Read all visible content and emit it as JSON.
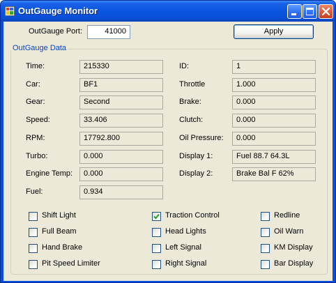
{
  "window": {
    "title": "OutGauge Monitor"
  },
  "port": {
    "label": "OutGauge Port:",
    "value": "41000",
    "apply_label": "Apply"
  },
  "group": {
    "title": "OutGauge Data"
  },
  "fields_left": [
    {
      "label": "Time:",
      "value": "215330"
    },
    {
      "label": "Car:",
      "value": "BF1"
    },
    {
      "label": "Gear:",
      "value": "Second"
    },
    {
      "label": "Speed:",
      "value": "33.406"
    },
    {
      "label": "RPM:",
      "value": "17792.800"
    },
    {
      "label": "Turbo:",
      "value": "0.000"
    },
    {
      "label": "Engine Temp:",
      "value": "0.000"
    },
    {
      "label": "Fuel:",
      "value": "0.934"
    }
  ],
  "fields_right": [
    {
      "label": "ID:",
      "value": "1"
    },
    {
      "label": "Throttle",
      "value": "1.000"
    },
    {
      "label": "Brake:",
      "value": "0.000"
    },
    {
      "label": "Clutch:",
      "value": "0.000"
    },
    {
      "label": "Oil Pressure:",
      "value": "0.000"
    },
    {
      "label": "Display 1:",
      "value": "Fuel 88.7  64.3L"
    },
    {
      "label": "Display 2:",
      "value": "Brake Bal F 62%"
    }
  ],
  "checkboxes": {
    "col1": [
      {
        "label": "Shift Light",
        "checked": false
      },
      {
        "label": "Full Beam",
        "checked": false
      },
      {
        "label": "Hand Brake",
        "checked": false
      },
      {
        "label": "Pit Speed Limiter",
        "checked": false
      }
    ],
    "col2": [
      {
        "label": "Traction Control",
        "checked": true
      },
      {
        "label": "Head Lights",
        "checked": false
      },
      {
        "label": "Left Signal",
        "checked": false
      },
      {
        "label": "Right Signal",
        "checked": false
      }
    ],
    "col3": [
      {
        "label": "Redline",
        "checked": false
      },
      {
        "label": "Oil Warn",
        "checked": false
      },
      {
        "label": "KM Display",
        "checked": false
      },
      {
        "label": "Bar Display",
        "checked": false
      }
    ]
  }
}
